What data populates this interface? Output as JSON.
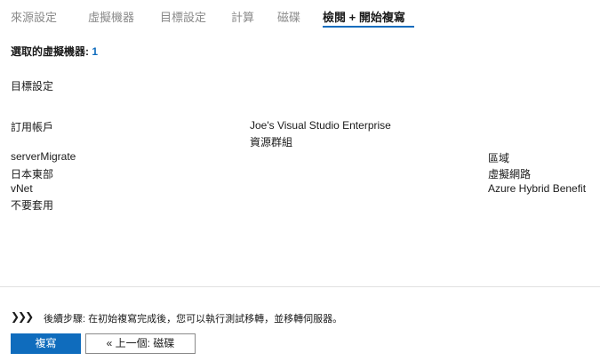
{
  "tabs": [
    {
      "label": "來源設定"
    },
    {
      "label": "虛擬機器"
    },
    {
      "label": "目標設定"
    },
    {
      "label": "計算"
    },
    {
      "label": "磁碟"
    },
    {
      "label": "檢閱 + 開始複寫"
    }
  ],
  "summary": {
    "label": "選取的虛擬機器:",
    "count": "1"
  },
  "section": {
    "title": "目標設定"
  },
  "fields": {
    "subscription_label": "訂用帳戶",
    "subscription_value": "Joe's Visual Studio Enterprise",
    "resource_group_label": "資源群組",
    "resource_group_value": "serverMigrate",
    "region_label": "區域",
    "region_value": "日本東部",
    "vnet_label": "虛擬網路",
    "vnet_value": "vNet",
    "ahb_label": "Azure Hybrid Benefit",
    "ahb_value": "不要套用"
  },
  "footer": {
    "chevron_glyph": "❯❯❯",
    "next_steps": "後續步驟: 在初始複寫完成後，您可以執行測試移轉，並移轉伺服器。",
    "replicate_button": "複寫",
    "previous_button": "« 上一個: 磁碟"
  },
  "colors": {
    "accent": "#0f6cbd"
  }
}
